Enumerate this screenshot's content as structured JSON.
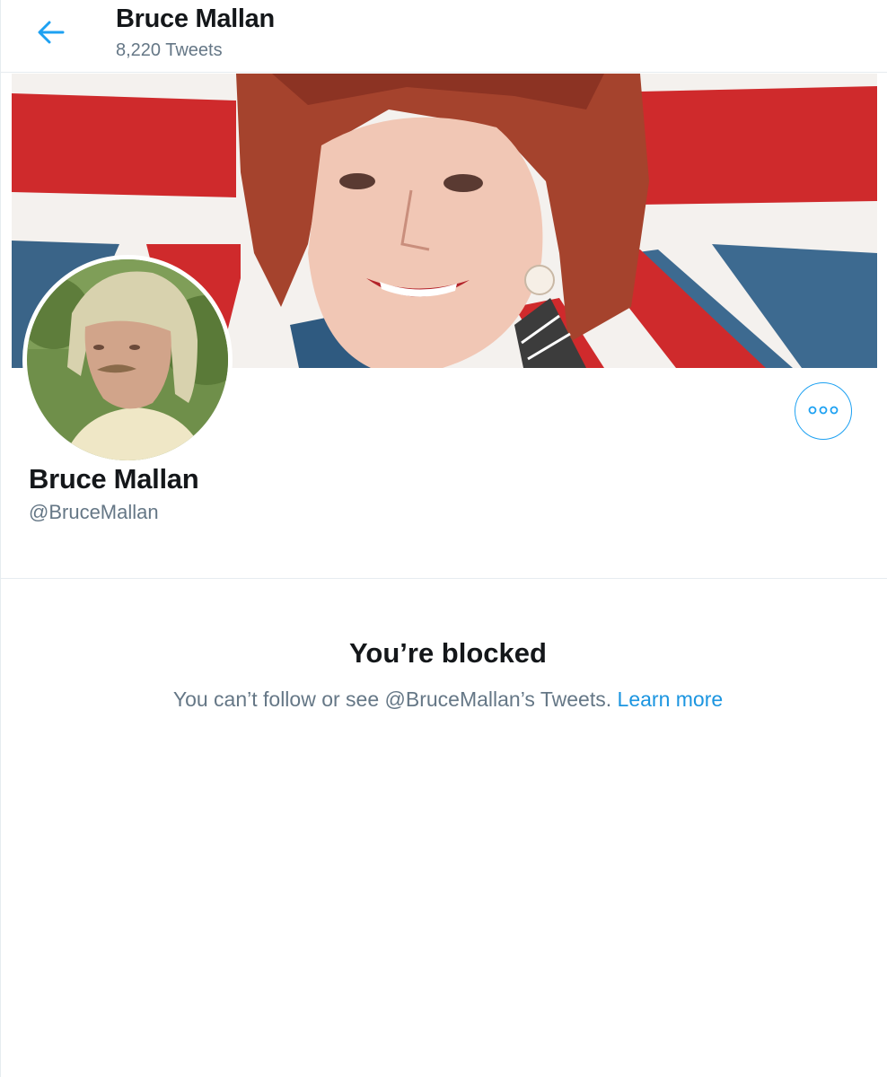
{
  "header": {
    "name": "Bruce Mallan",
    "tweet_count": "8,220 Tweets",
    "back_icon": "arrow-left-icon"
  },
  "profile": {
    "display_name": "Bruce Mallan",
    "handle": "@BruceMallan",
    "more_icon": "more-options-icon"
  },
  "blocked": {
    "title": "You’re blocked",
    "message": "You can’t follow or see @BruceMallan’s Tweets.",
    "learn_more": "Learn more"
  },
  "colors": {
    "accent": "#1da1f2",
    "link": "#1b95e0",
    "text_primary": "#14171a",
    "text_secondary": "#657786"
  }
}
